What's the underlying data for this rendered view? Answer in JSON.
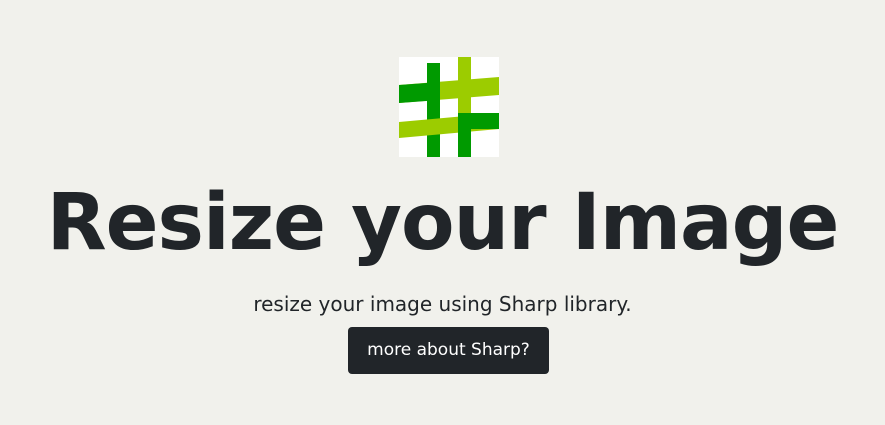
{
  "hero": {
    "logo_icon": "hashtag-logo-icon",
    "title": "Resize your Image",
    "subtitle": "resize your image using Sharp library.",
    "cta_label": "more about Sharp?"
  },
  "colors": {
    "background": "#f1f1ec",
    "text": "#212529",
    "button_bg": "#212529",
    "button_text": "#ffffff",
    "logo_dark_green": "#009a00",
    "logo_light_green": "#9ccc00"
  }
}
